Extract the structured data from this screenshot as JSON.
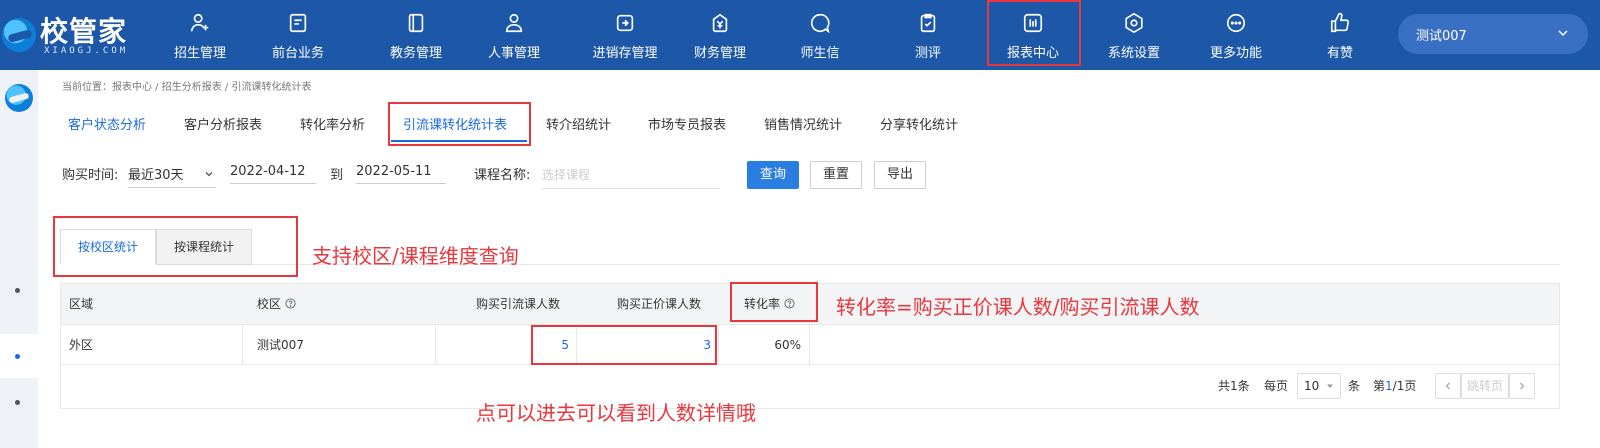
{
  "brand": {
    "title": "校管家",
    "subtitle": "XIAOGJ.COM"
  },
  "nav": [
    {
      "label": "招生管理",
      "icon": "user-add-icon"
    },
    {
      "label": "前台业务",
      "icon": "monitor-icon"
    },
    {
      "label": "教务管理",
      "icon": "book-icon"
    },
    {
      "label": "人事管理",
      "icon": "person-icon"
    },
    {
      "label": "进销存管理",
      "icon": "inventory-icon"
    },
    {
      "label": "财务管理",
      "icon": "yuan-icon"
    },
    {
      "label": "师生信",
      "icon": "chat-icon"
    },
    {
      "label": "测评",
      "icon": "clipboard-check-icon"
    },
    {
      "label": "报表中心",
      "icon": "bar-report-icon"
    },
    {
      "label": "系统设置",
      "icon": "gear-icon"
    },
    {
      "label": "更多功能",
      "icon": "more-icon"
    },
    {
      "label": "有赞",
      "icon": "thumbs-up-icon"
    }
  ],
  "user": {
    "name": "测试007"
  },
  "breadcrumb": "当前位置：报表中心 / 招生分析报表 / 引流课转化统计表",
  "subtabs": [
    "客户状态分析",
    "客户分析报表",
    "转化率分析",
    "引流课转化统计表",
    "转介绍统计",
    "市场专员报表",
    "销售情况统计",
    "分享转化统计"
  ],
  "filter": {
    "buy_time_label": "购买时间:",
    "period": "最近30天",
    "start_date": "2022-04-12",
    "to_label": "到",
    "end_date": "2022-05-11",
    "course_label": "课程名称:",
    "course_placeholder": "选择课程",
    "query_btn": "查询",
    "reset_btn": "重置",
    "export_btn": "导出"
  },
  "inner_tabs": [
    "按校区统计",
    "按课程统计"
  ],
  "annotations": {
    "dimension": "支持校区/课程维度查询",
    "formula": "转化率=购买正价课人数/购买引流课人数",
    "click_hint": "点可以进去可以看到人数详情哦"
  },
  "table": {
    "headers": [
      "区域",
      "校区",
      "购买引流课人数",
      "购买正价课人数",
      "转化率"
    ],
    "rows": [
      {
        "region": "外区",
        "campus": "测试007",
        "trial_buyers": "5",
        "regular_buyers": "3",
        "rate": "60%"
      }
    ]
  },
  "pagination": {
    "total": "共1条",
    "per_page_label": "每页",
    "per_page": "10",
    "unit": "条",
    "page_prefix": "第",
    "page_current": "1",
    "page_suffix": "/1页",
    "jump_placeholder": "跳转页"
  },
  "colors": {
    "nav_bg": "#1c57a8",
    "accent": "#1a6be0",
    "annotation": "#e8383d"
  }
}
